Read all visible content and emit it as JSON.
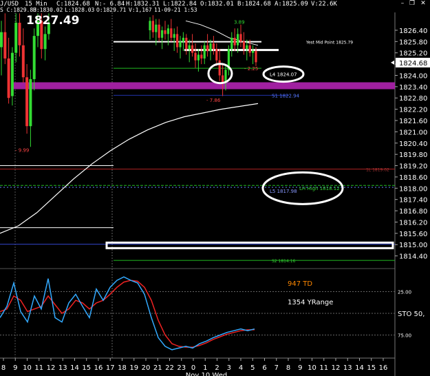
{
  "header": {
    "symbol_prefix": "J/USD",
    "interval": "15 Min",
    "close": "C:1824.68",
    "net": "N:- 6.84",
    "high": "H:1832.31",
    "low": "L:1822.84",
    "open": "O:1832.01",
    "bid": "B:1824.68",
    "ask": "A:1825.09",
    "volume": "V:22.6K",
    "line2_prefix": "S C:1829.83",
    "line2_high": "H:1830.02",
    "line2_low": "L:1828.03",
    "line2_open": "O:1829.71",
    "line2_vol": "V:1,167",
    "line2_time": "11-09-21 1:53",
    "big_price": "1827.49"
  },
  "window_icons": [
    "minimize-icon",
    "restore-icon",
    "close-icon"
  ],
  "colors": {
    "background": "#000000",
    "bull": "#33dd33",
    "bear": "#ee3333",
    "sma_line": "#ffffff",
    "pivot_line": "#aa2222",
    "support_line": "#2233aa",
    "green_dashed": "#22bb22",
    "highlight_band": "#a020a0",
    "stoch_k": "#33aaff",
    "stoch_d": "#ee2222",
    "orange_text": "#ff8800"
  },
  "chart_data": {
    "type": "candlestick",
    "y_range": [
      1813.8,
      1827.35
    ],
    "y_ticks": [
      "1826.40",
      "1825.80",
      "1825.20",
      "1824.60",
      "1824.00",
      "1823.40",
      "1822.80",
      "1822.20",
      "1821.60",
      "1821.00",
      "1820.40",
      "1819.80",
      "1819.20",
      "1818.60",
      "1818.00",
      "1817.40",
      "1816.80",
      "1816.20",
      "1815.60",
      "1815.00",
      "1814.40"
    ],
    "last_price_tag": "1824.68",
    "x_tick_labels": [
      "8",
      "9",
      "10",
      "11",
      "12",
      "13",
      "14",
      "15",
      "16",
      "17",
      "18",
      "19",
      "20",
      "21",
      "22",
      "23",
      "0",
      "1",
      "2",
      "3",
      "4",
      "5",
      "6",
      "7",
      "8",
      "9",
      "10",
      "11",
      "12",
      "13",
      "14",
      "15",
      "16"
    ],
    "date_label": "Nov 10 Wed",
    "candles_left": [
      {
        "slot": 0,
        "o": 1825.5,
        "h": 1826.9,
        "l": 1824.0,
        "c": 1826.3
      },
      {
        "slot": 1,
        "o": 1826.3,
        "h": 1827.3,
        "l": 1824.6,
        "c": 1824.9
      },
      {
        "slot": 2,
        "o": 1824.9,
        "h": 1826.0,
        "l": 1822.5,
        "c": 1822.8
      },
      {
        "slot": 3,
        "o": 1822.9,
        "h": 1825.5,
        "l": 1822.4,
        "c": 1825.2
      },
      {
        "slot": 4,
        "o": 1825.2,
        "h": 1827.3,
        "l": 1824.7,
        "c": 1826.8
      },
      {
        "slot": 5,
        "o": 1826.8,
        "h": 1827.3,
        "l": 1825.0,
        "c": 1825.6
      },
      {
        "slot": 6,
        "o": 1825.6,
        "h": 1826.5,
        "l": 1823.6,
        "c": 1823.9
      },
      {
        "slot": 7,
        "o": 1823.9,
        "h": 1824.6,
        "l": 1820.9,
        "c": 1821.3
      },
      {
        "slot": 8,
        "o": 1821.3,
        "h": 1824.3,
        "l": 1820.2,
        "c": 1823.8
      },
      {
        "slot": 9,
        "o": 1823.8,
        "h": 1826.5,
        "l": 1823.2,
        "c": 1826.1
      },
      {
        "slot": 10,
        "o": 1826.1,
        "h": 1827.3,
        "l": 1825.5,
        "c": 1826.9
      },
      {
        "slot": 11,
        "o": 1826.9,
        "h": 1827.3,
        "l": 1824.9,
        "c": 1825.4
      },
      {
        "slot": 12,
        "o": 1825.4,
        "h": 1826.6,
        "l": 1824.8,
        "c": 1826.2
      },
      {
        "slot": 13,
        "o": 1826.2,
        "h": 1827.3,
        "l": 1825.9,
        "c": 1826.8
      }
    ],
    "candles_right": [
      {
        "slot": 0,
        "o": 1826.4,
        "h": 1827.1,
        "l": 1825.9,
        "c": 1826.9
      },
      {
        "slot": 1,
        "o": 1826.9,
        "h": 1827.2,
        "l": 1826.0,
        "c": 1826.3
      },
      {
        "slot": 2,
        "o": 1826.3,
        "h": 1827.0,
        "l": 1825.6,
        "c": 1826.7
      },
      {
        "slot": 3,
        "o": 1826.7,
        "h": 1827.0,
        "l": 1825.8,
        "c": 1826.0
      },
      {
        "slot": 4,
        "o": 1826.0,
        "h": 1826.6,
        "l": 1825.4,
        "c": 1826.4
      },
      {
        "slot": 5,
        "o": 1826.4,
        "h": 1826.9,
        "l": 1825.9,
        "c": 1826.2
      },
      {
        "slot": 6,
        "o": 1826.2,
        "h": 1826.7,
        "l": 1825.6,
        "c": 1826.5
      },
      {
        "slot": 7,
        "o": 1826.5,
        "h": 1827.0,
        "l": 1825.8,
        "c": 1826.0
      },
      {
        "slot": 8,
        "o": 1826.0,
        "h": 1826.5,
        "l": 1825.3,
        "c": 1826.2
      },
      {
        "slot": 9,
        "o": 1826.2,
        "h": 1826.6,
        "l": 1825.2,
        "c": 1825.5
      },
      {
        "slot": 10,
        "o": 1825.5,
        "h": 1826.1,
        "l": 1824.9,
        "c": 1825.8
      },
      {
        "slot": 11,
        "o": 1825.8,
        "h": 1826.3,
        "l": 1825.3,
        "c": 1826.0
      },
      {
        "slot": 12,
        "o": 1826.0,
        "h": 1826.2,
        "l": 1825.1,
        "c": 1825.4
      },
      {
        "slot": 13,
        "o": 1825.4,
        "h": 1825.9,
        "l": 1824.7,
        "c": 1825.6
      },
      {
        "slot": 14,
        "o": 1825.6,
        "h": 1826.2,
        "l": 1825.0,
        "c": 1825.2
      },
      {
        "slot": 15,
        "o": 1825.2,
        "h": 1825.7,
        "l": 1824.4,
        "c": 1824.8
      },
      {
        "slot": 16,
        "o": 1824.8,
        "h": 1825.4,
        "l": 1824.2,
        "c": 1825.1
      },
      {
        "slot": 17,
        "o": 1825.1,
        "h": 1825.6,
        "l": 1824.6,
        "c": 1824.9
      },
      {
        "slot": 18,
        "o": 1824.9,
        "h": 1825.8,
        "l": 1824.6,
        "c": 1825.6
      },
      {
        "slot": 19,
        "o": 1825.6,
        "h": 1826.2,
        "l": 1825.0,
        "c": 1825.3
      },
      {
        "slot": 20,
        "o": 1825.3,
        "h": 1825.9,
        "l": 1824.8,
        "c": 1825.7
      },
      {
        "slot": 21,
        "o": 1825.7,
        "h": 1826.1,
        "l": 1825.1,
        "c": 1825.4
      },
      {
        "slot": 22,
        "o": 1825.4,
        "h": 1825.7,
        "l": 1824.5,
        "c": 1824.8
      },
      {
        "slot": 23,
        "o": 1824.8,
        "h": 1825.4,
        "l": 1823.7,
        "c": 1824.0
      },
      {
        "slot": 24,
        "o": 1824.0,
        "h": 1824.6,
        "l": 1822.9,
        "c": 1823.6
      },
      {
        "slot": 25,
        "o": 1823.6,
        "h": 1824.5,
        "l": 1823.2,
        "c": 1824.3
      },
      {
        "slot": 26,
        "o": 1824.3,
        "h": 1825.6,
        "l": 1824.0,
        "c": 1825.4
      },
      {
        "slot": 27,
        "o": 1825.4,
        "h": 1826.3,
        "l": 1825.0,
        "c": 1826.0
      },
      {
        "slot": 28,
        "o": 1826.0,
        "h": 1826.5,
        "l": 1825.3,
        "c": 1825.6
      },
      {
        "slot": 29,
        "o": 1825.6,
        "h": 1826.5,
        "l": 1825.2,
        "c": 1826.2
      },
      {
        "slot": 30,
        "o": 1826.2,
        "h": 1826.7,
        "l": 1825.5,
        "c": 1825.8
      },
      {
        "slot": 31,
        "o": 1825.8,
        "h": 1826.3,
        "l": 1825.1,
        "c": 1825.4
      },
      {
        "slot": 32,
        "o": 1825.4,
        "h": 1825.9,
        "l": 1824.8,
        "c": 1825.6
      },
      {
        "slot": 33,
        "o": 1825.6,
        "h": 1825.9,
        "l": 1825.0,
        "c": 1825.2
      },
      {
        "slot": 34,
        "o": 1825.2,
        "h": 1825.6,
        "l": 1824.6,
        "c": 1825.3
      },
      {
        "slot": 35,
        "o": 1825.3,
        "h": 1825.5,
        "l": 1824.5,
        "c": 1824.7
      }
    ],
    "sma": [
      [
        1815.2,
        1822.6
      ],
      [
        1815.5,
        1822.8
      ],
      [
        1816.1,
        1823.1
      ],
      [
        1816.9,
        1823.5
      ],
      [
        1817.8,
        1823.9
      ],
      [
        1818.8,
        1824.3
      ],
      [
        1819.8,
        1824.7
      ],
      [
        1820.6,
        1825.1
      ],
      [
        1821.2,
        1825.5
      ],
      [
        1821.6,
        1825.9
      ],
      [
        1821.9,
        1826.2
      ],
      [
        1822.1,
        1826.4
      ],
      [
        1822.2,
        1826.6
      ],
      [
        1822.4,
        1826.7
      ],
      [
        1822.5,
        1826.5
      ]
    ],
    "levels": [
      {
        "label": "Yest Mid Point 1825.79",
        "price": 1825.79
      },
      {
        "label": "- 2.25",
        "price": 1824.38
      },
      {
        "label": "L4 1824.07",
        "price": 1824.07
      },
      {
        "label": "S1 1822.94",
        "price": 1822.94
      },
      {
        "label": "- 7.86",
        "price": 1822.7
      },
      {
        "label": "1L 1819.02",
        "price": 1819.02
      },
      {
        "label": "L5 1817.98",
        "price": 1817.98
      },
      {
        "label": "LH High 1818.12",
        "price": 1818.12
      },
      {
        "label": "S2 1814.16",
        "price": 1814.16
      },
      {
        "label": "3.89",
        "price": 1826.85
      },
      {
        "label": "- 9.99",
        "price": 1820.05
      }
    ],
    "stochastic": {
      "label": "STO  50,",
      "y_ticks": [
        "25.00",
        "75.00"
      ],
      "k": [
        55,
        42,
        15,
        48,
        60,
        30,
        45,
        10,
        55,
        60,
        38,
        28,
        42,
        55,
        22,
        35,
        20,
        12,
        8,
        12,
        15,
        28,
        55,
        78,
        88,
        92,
        90,
        88,
        90,
        85,
        82,
        78,
        75,
        72,
        70,
        68,
        70,
        68
      ],
      "d": [
        48,
        45,
        30,
        35,
        48,
        45,
        42,
        30,
        40,
        50,
        45,
        35,
        38,
        45,
        38,
        35,
        28,
        20,
        14,
        12,
        13,
        20,
        35,
        58,
        75,
        85,
        88,
        89,
        89,
        87,
        84,
        80,
        77,
        74,
        72,
        70,
        69,
        69
      ],
      "k_right": [
        88,
        90,
        87,
        85,
        88,
        80,
        82,
        78,
        75,
        70,
        68,
        72,
        66,
        70,
        74,
        72
      ],
      "d_right": [
        86,
        88,
        88,
        87,
        86,
        84,
        82,
        80,
        78,
        75,
        72,
        71,
        70,
        70,
        72,
        73
      ],
      "annotations": [
        "947 TD",
        "1354 YRange"
      ]
    }
  }
}
